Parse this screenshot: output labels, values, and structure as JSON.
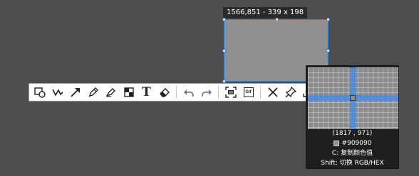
{
  "selection": {
    "size_label": "1566,851 - 339 x 198",
    "fill_color": "#909090",
    "border_color": "#2f7fd8"
  },
  "toolbar": {
    "tools": [
      {
        "name": "shape-tool",
        "icon": "shape-icon"
      },
      {
        "name": "polyline-tool",
        "icon": "polyline-icon"
      },
      {
        "name": "arrow-tool",
        "icon": "arrow-icon"
      },
      {
        "name": "pen-tool",
        "icon": "pencil-icon"
      },
      {
        "name": "highlighter-tool",
        "icon": "marker-icon"
      },
      {
        "name": "mosaic-tool",
        "icon": "mosaic-icon"
      },
      {
        "name": "text-tool",
        "icon": "text-icon"
      },
      {
        "name": "eraser-tool",
        "icon": "eraser-icon"
      },
      {
        "name": "undo-button",
        "icon": "undo-icon"
      },
      {
        "name": "redo-button",
        "icon": "redo-icon"
      },
      {
        "name": "ocr-button",
        "icon": "scan-icon"
      },
      {
        "name": "gif-button",
        "icon": "gif-icon"
      },
      {
        "name": "cancel-button",
        "icon": "close-icon"
      },
      {
        "name": "pin-button",
        "icon": "pin-icon"
      },
      {
        "name": "save-button",
        "icon": "download-icon"
      }
    ],
    "text_glyph": "T",
    "gif_label": "Gif"
  },
  "magnifier": {
    "coords": "(1817 , 971)",
    "color_hex": "#909090",
    "copy_hint": "C: 复制颜色值",
    "switch_hint": "Shift: 切换 RGB/HEX",
    "accent_color": "#468ce6"
  }
}
